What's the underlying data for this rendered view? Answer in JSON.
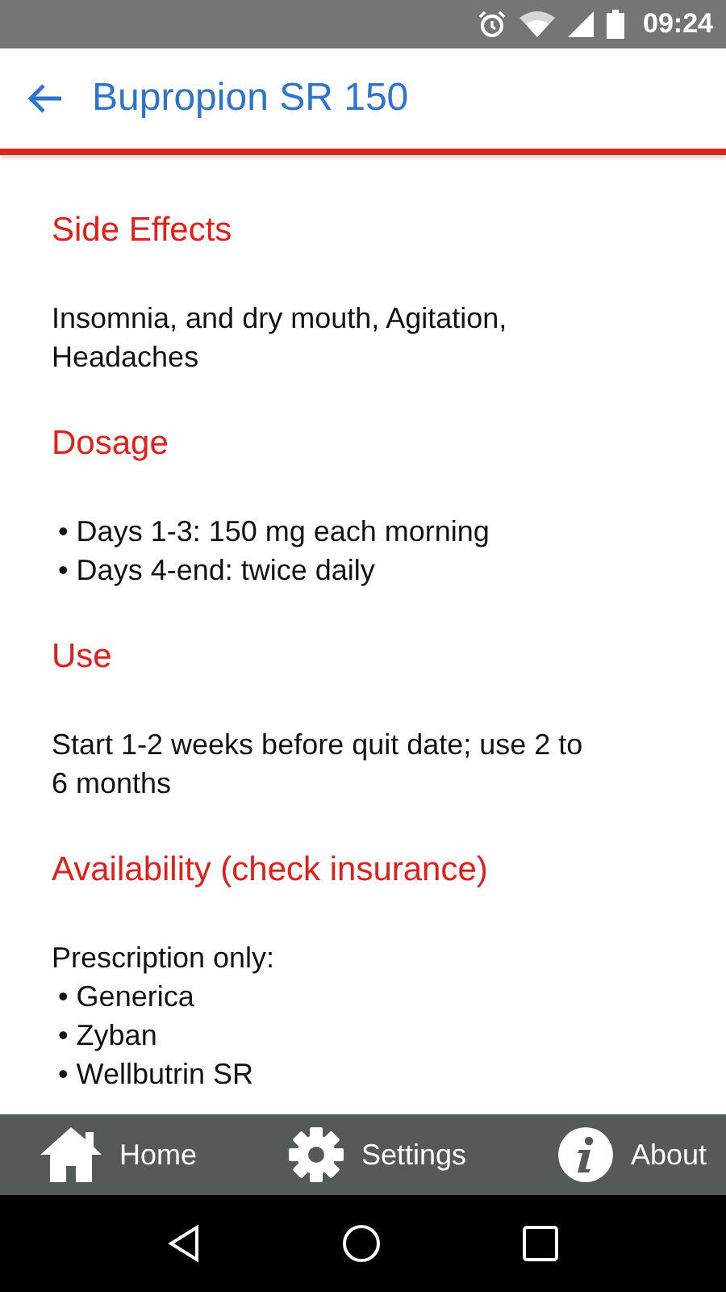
{
  "status_bar": {
    "time": "09:24"
  },
  "app_bar": {
    "title": "Bupropion SR 150"
  },
  "sections": [
    {
      "heading": "Side Effects",
      "blocks": [
        {
          "kind": "paragraph",
          "text": "Insomnia, and dry mouth, Agitation, Headaches"
        }
      ]
    },
    {
      "heading": "Dosage",
      "blocks": [
        {
          "kind": "bullet",
          "text": "• Days 1-3: 150 mg each morning"
        },
        {
          "kind": "bullet",
          "text": "• Days 4-end: twice daily"
        }
      ]
    },
    {
      "heading": "Use",
      "blocks": [
        {
          "kind": "paragraph",
          "text": "Start 1-2 weeks before quit date; use 2 to 6 months"
        }
      ]
    },
    {
      "heading": "Availability (check insurance)",
      "blocks": [
        {
          "kind": "paragraph",
          "text": "Prescription only:"
        },
        {
          "kind": "bullet",
          "text": "• Generica"
        },
        {
          "kind": "bullet",
          "text": "• Zyban"
        },
        {
          "kind": "bullet",
          "text": "• Wellbutrin SR"
        }
      ]
    }
  ],
  "bottom_nav": [
    {
      "kind": "home",
      "label": "Home"
    },
    {
      "kind": "settings",
      "label": "Settings"
    },
    {
      "kind": "about",
      "label": "About"
    }
  ]
}
